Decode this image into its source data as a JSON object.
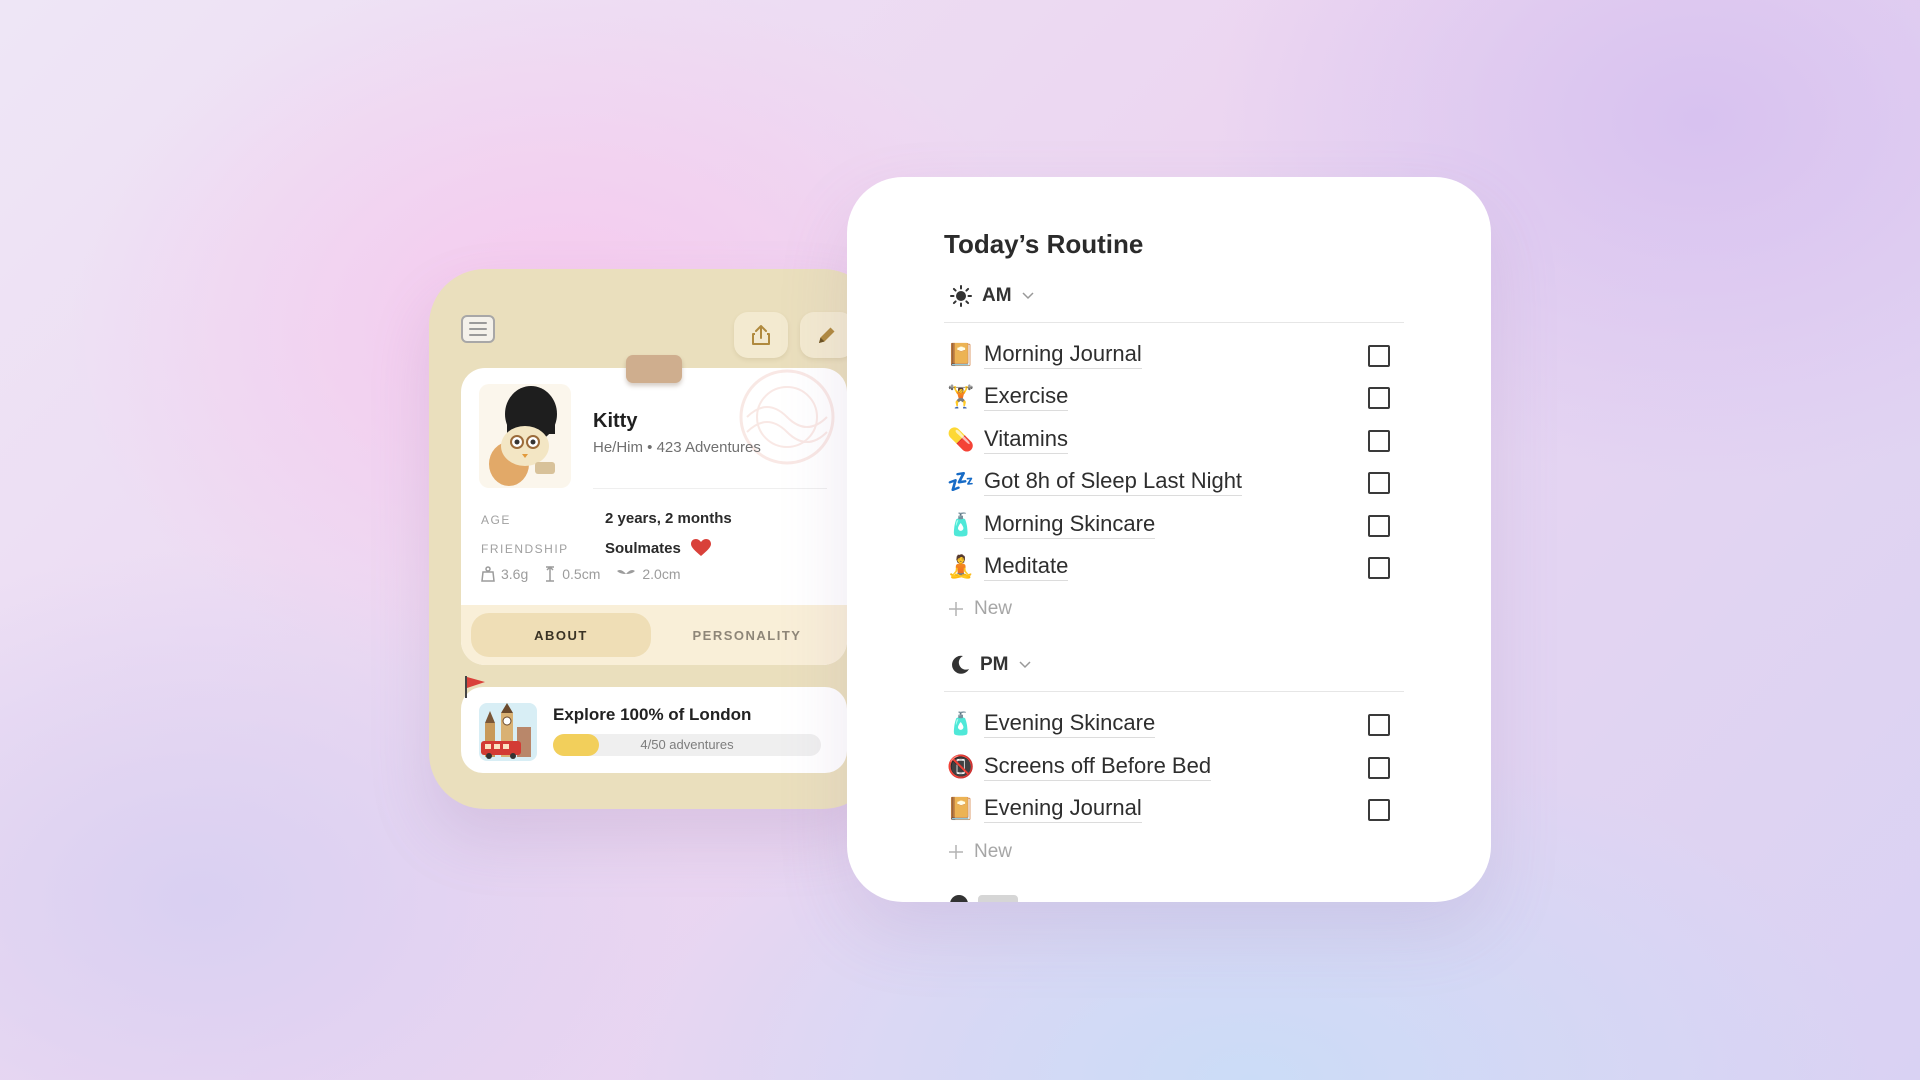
{
  "pet": {
    "name": "Kitty",
    "subtitle": "He/Him • 423 Adventures",
    "age_label": "AGE",
    "age_value": "2 years, 2 months",
    "friendship_label": "FRIENDSHIP",
    "friendship_value": "Soulmates",
    "weight": "3.6g",
    "height": "0.5cm",
    "wingspan": "2.0cm",
    "tabs": [
      {
        "label": "ABOUT",
        "active": true
      },
      {
        "label": "PERSONALITY",
        "active": false
      }
    ]
  },
  "goal": {
    "title": "Explore 100% of London",
    "progress_text": "4/50 adventures",
    "progress_value": 0.08
  },
  "routine": {
    "title": "Today’s Routine",
    "sections": [
      {
        "name": "AM",
        "icon": "sun-icon",
        "tasks": [
          {
            "emoji": "📔",
            "label": "Morning Journal",
            "checked": false
          },
          {
            "emoji": "🏋️",
            "label": "Exercise",
            "checked": false
          },
          {
            "emoji": "💊",
            "label": "Vitamins",
            "checked": false
          },
          {
            "emoji": "💤",
            "label": "Got 8h of Sleep Last Night",
            "checked": false
          },
          {
            "emoji": "🧴",
            "label": "Morning Skincare",
            "checked": false
          },
          {
            "emoji": "🧘",
            "label": "Meditate",
            "checked": false
          }
        ],
        "new_label": "New"
      },
      {
        "name": "PM",
        "icon": "moon-icon",
        "tasks": [
          {
            "emoji": "🧴",
            "label": "Evening Skincare",
            "checked": false
          },
          {
            "emoji": "📵",
            "label": "Screens off Before Bed",
            "checked": false
          },
          {
            "emoji": "📔",
            "label": "Evening Journal",
            "checked": false
          }
        ],
        "new_label": "New"
      }
    ]
  },
  "colors": {
    "card_bg": "#eadfbd",
    "tab_active": "#efdeb6",
    "progress_fill": "#f2cf5b",
    "heart": "#d9413a"
  }
}
